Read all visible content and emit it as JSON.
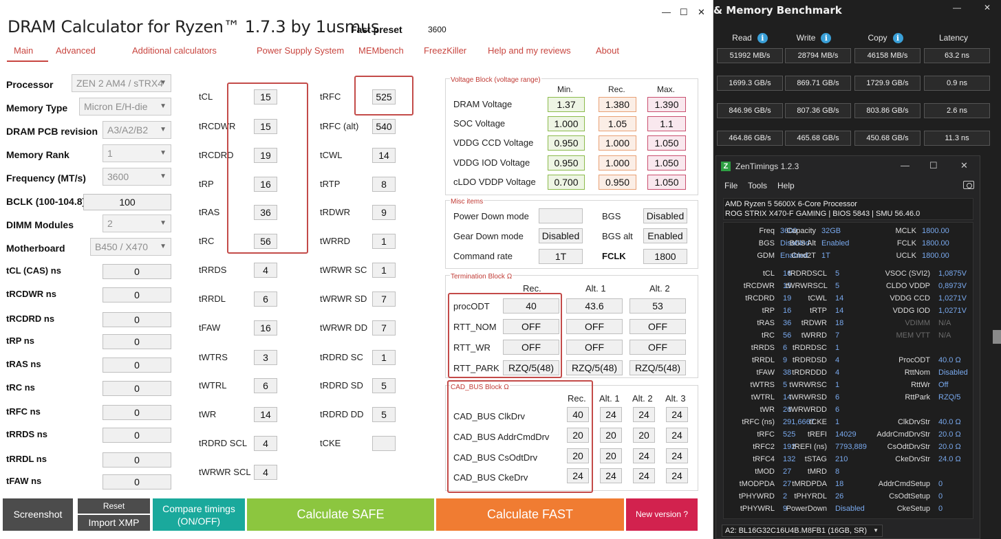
{
  "bench": {
    "title": "& Memory Benchmark",
    "headers": [
      "Read",
      "Write",
      "Copy",
      "Latency"
    ],
    "rows": [
      [
        "51992 MB/s",
        "28794 MB/s",
        "46158 MB/s",
        "63.2 ns"
      ],
      [
        "1699.3 GB/s",
        "869.71 GB/s",
        "1729.9 GB/s",
        "0.9 ns"
      ],
      [
        "846.96 GB/s",
        "807.36 GB/s",
        "803.86 GB/s",
        "2.6 ns"
      ],
      [
        "464.86 GB/s",
        "465.68 GB/s",
        "450.68 GB/s",
        "11.3 ns"
      ]
    ]
  },
  "zen": {
    "title": "ZenTimings 1.2.3",
    "menu": [
      "File",
      "Tools",
      "Help"
    ],
    "cpu": "AMD Ryzen 5 5600X 6-Core Processor",
    "board": "ROG STRIX X470-F GAMING | BIOS 5843 | SMU 56.46.0",
    "top": [
      [
        "Freq",
        "3600",
        "Capacity",
        "32GB",
        "MCLK",
        "1800.00"
      ],
      [
        "BGS",
        "Disabled",
        "BGS Alt",
        "Enabled",
        "FCLK",
        "1800.00"
      ],
      [
        "GDM",
        "Enabled",
        "Cmd2T",
        "1T",
        "UCLK",
        "1800.00"
      ]
    ],
    "rows": [
      [
        "tCL",
        "16",
        "tRDRDSCL",
        "5",
        "VSOC (SVI2)",
        "1,0875V"
      ],
      [
        "tRCDWR",
        "15",
        "tWRWRSCL",
        "5",
        "CLDO VDDP",
        "0,8973V"
      ],
      [
        "tRCDRD",
        "19",
        "tCWL",
        "14",
        "VDDG CCD",
        "1,0271V"
      ],
      [
        "tRP",
        "16",
        "tRTP",
        "14",
        "VDDG IOD",
        "1,0271V"
      ],
      [
        "tRAS",
        "36",
        "tRDWR",
        "18",
        "VDIMM",
        "N/A"
      ],
      [
        "tRC",
        "56",
        "tWRRD",
        "7",
        "MEM VTT",
        "N/A"
      ],
      [
        "tRRDS",
        "6",
        "tRDRDSC",
        "1",
        "",
        ""
      ],
      [
        "tRRDL",
        "9",
        "tRDRDSD",
        "4",
        "ProcODT",
        "40.0 Ω"
      ],
      [
        "tFAW",
        "38",
        "tRDRDDD",
        "4",
        "RttNom",
        "Disabled"
      ],
      [
        "tWTRS",
        "5",
        "tWRWRSC",
        "1",
        "RttWr",
        "Off"
      ],
      [
        "tWTRL",
        "14",
        "tWRWRSD",
        "6",
        "RttPark",
        "RZQ/5"
      ],
      [
        "tWR",
        "26",
        "tWRWRDD",
        "6",
        "",
        ""
      ],
      [
        "tRFC (ns)",
        "291,6667",
        "tCKE",
        "1",
        "ClkDrvStr",
        "40.0 Ω"
      ],
      [
        "tRFC",
        "525",
        "tREFI",
        "14029",
        "AddrCmdDrvStr",
        "20.0 Ω"
      ],
      [
        "tRFC2",
        "192",
        "tREFI (ns)",
        "7793,889",
        "CsOdtDrvStr",
        "20.0 Ω"
      ],
      [
        "tRFC4",
        "132",
        "tSTAG",
        "210",
        "CkeDrvStr",
        "24.0 Ω"
      ],
      [
        "tMOD",
        "27",
        "tMRD",
        "8",
        "",
        ""
      ],
      [
        "tMODPDA",
        "27",
        "tMRDPDA",
        "18",
        "AddrCmdSetup",
        "0"
      ],
      [
        "tPHYWRD",
        "2",
        "tPHYRDL",
        "26",
        "CsOdtSetup",
        "0"
      ],
      [
        "tPHYWRL",
        "9",
        "PowerDown",
        "Disabled",
        "CkeSetup",
        "0"
      ]
    ],
    "dimm": "A2: BL16G32C16U4B.M8FB1 (16GB, SR)"
  },
  "calc": {
    "title": "DRAM Calculator for Ryzen™ 1.7.3 by 1usmus",
    "preset_label": "Fast preset",
    "preset_value": "3600",
    "tabs": [
      "Main",
      "Advanced",
      "Additional calculators",
      "Power Supply System",
      "MEMbench",
      "FreezKiller",
      "Help and my reviews",
      "About"
    ],
    "left": [
      {
        "label": "Processor",
        "value": "ZEN 2 AM4 / sTRX4"
      },
      {
        "label": "Memory Type",
        "value": "Micron E/H-die"
      },
      {
        "label": "DRAM PCB revision",
        "value": "A3/A2/B2"
      },
      {
        "label": "Memory Rank",
        "value": "1"
      },
      {
        "label": "Frequency (MT/s)",
        "value": "3600"
      },
      {
        "label": "BCLK (100-104.8)",
        "value": "100"
      },
      {
        "label": "DIMM Modules",
        "value": "2"
      },
      {
        "label": "Motherboard",
        "value": "B450 / X470"
      }
    ],
    "ns": [
      {
        "label": "tCL (CAS) ns",
        "value": "0"
      },
      {
        "label": "tRCDWR ns",
        "value": "0"
      },
      {
        "label": "tRCDRD ns",
        "value": "0"
      },
      {
        "label": "tRP ns",
        "value": "0"
      },
      {
        "label": "tRAS ns",
        "value": "0"
      },
      {
        "label": "tRC ns",
        "value": "0"
      },
      {
        "label": "tRFC ns",
        "value": "0"
      },
      {
        "label": "tRRDS ns",
        "value": "0"
      },
      {
        "label": "tRRDL ns",
        "value": "0"
      },
      {
        "label": "tFAW ns",
        "value": "0"
      }
    ],
    "t1": [
      {
        "label": "tCL",
        "value": "15"
      },
      {
        "label": "tRCDWR",
        "value": "15"
      },
      {
        "label": "tRCDRD",
        "value": "19"
      },
      {
        "label": "tRP",
        "value": "16"
      },
      {
        "label": "tRAS",
        "value": "36"
      },
      {
        "label": "tRC",
        "value": "56"
      },
      {
        "label": "tRRDS",
        "value": "4"
      },
      {
        "label": "tRRDL",
        "value": "6"
      },
      {
        "label": "tFAW",
        "value": "16"
      },
      {
        "label": "tWTRS",
        "value": "3"
      },
      {
        "label": "tWTRL",
        "value": "6"
      },
      {
        "label": "tWR",
        "value": "14"
      },
      {
        "label": "tRDRD SCL",
        "value": "4"
      },
      {
        "label": "tWRWR SCL",
        "value": "4"
      }
    ],
    "t2": [
      {
        "label": "tRFC",
        "value": "525"
      },
      {
        "label": "tRFC (alt)",
        "value": "540"
      },
      {
        "label": "tCWL",
        "value": "14"
      },
      {
        "label": "tRTP",
        "value": "8"
      },
      {
        "label": "tRDWR",
        "value": "9"
      },
      {
        "label": "tWRRD",
        "value": "1"
      },
      {
        "label": "tWRWR SC",
        "value": "1"
      },
      {
        "label": "tWRWR SD",
        "value": "7"
      },
      {
        "label": "tWRWR DD",
        "value": "7"
      },
      {
        "label": "tRDRD SC",
        "value": "1"
      },
      {
        "label": "tRDRD SD",
        "value": "5"
      },
      {
        "label": "tRDRD DD",
        "value": "5"
      },
      {
        "label": "tCKE",
        "value": ""
      }
    ],
    "voltage": {
      "title": "Voltage Block (voltage range)",
      "cols": [
        "Min.",
        "Rec.",
        "Max."
      ],
      "rows": [
        {
          "label": "DRAM Voltage",
          "min": "1.37",
          "rec": "1.380",
          "max": "1.390"
        },
        {
          "label": "SOC Voltage",
          "min": "1.000",
          "rec": "1.05",
          "max": "1.1"
        },
        {
          "label": "VDDG  CCD Voltage",
          "min": "0.950",
          "rec": "1.000",
          "max": "1.050"
        },
        {
          "label": "VDDG  IOD Voltage",
          "min": "0.950",
          "rec": "1.000",
          "max": "1.050"
        },
        {
          "label": "cLDO VDDP Voltage",
          "min": "0.700",
          "rec": "0.950",
          "max": "1.050"
        }
      ]
    },
    "misc": {
      "title": "Misc items",
      "power_down_label": "Power Down mode",
      "power_down_value": "",
      "gear_down_label": "Gear Down mode",
      "gear_down_value": "Disabled",
      "cmd_rate_label": "Command rate",
      "cmd_rate_value": "1T",
      "bgs_label": "BGS",
      "bgs_value": "Disabled",
      "bgs_alt_label": "BGS alt",
      "bgs_alt_value": "Enabled",
      "fclk_label": "FCLK",
      "fclk_value": "1800"
    },
    "term": {
      "title": "Termination Block Ω",
      "cols": [
        "Rec.",
        "Alt. 1",
        "Alt. 2"
      ],
      "rows": [
        {
          "label": "procODT",
          "v": [
            "40",
            "43.6",
            "53"
          ]
        },
        {
          "label": "RTT_NOM",
          "v": [
            "OFF",
            "OFF",
            "OFF"
          ]
        },
        {
          "label": "RTT_WR",
          "v": [
            "OFF",
            "OFF",
            "OFF"
          ]
        },
        {
          "label": "RTT_PARK",
          "v": [
            "RZQ/5(48)",
            "RZQ/5(48)",
            "RZQ/5(48)"
          ]
        }
      ]
    },
    "cad": {
      "title": "CAD_BUS Block Ω",
      "cols": [
        "Rec.",
        "Alt. 1",
        "Alt. 2",
        "Alt. 3"
      ],
      "rows": [
        {
          "label": "CAD_BUS ClkDrv",
          "v": [
            "40",
            "24",
            "24",
            "24"
          ]
        },
        {
          "label": "CAD_BUS AddrCmdDrv",
          "v": [
            "20",
            "20",
            "20",
            "24"
          ]
        },
        {
          "label": "CAD_BUS CsOdtDrv",
          "v": [
            "20",
            "20",
            "24",
            "24"
          ]
        },
        {
          "label": "CAD_BUS CkeDrv",
          "v": [
            "24",
            "24",
            "24",
            "24"
          ]
        }
      ]
    },
    "buttons": {
      "screenshot": "Screenshot",
      "reset": "Reset",
      "import": "Import XMP",
      "compare1": "Compare timings",
      "compare2": "(ON/OFF)",
      "safe": "Calculate SAFE",
      "fast": "Calculate FAST",
      "new": "New version ?"
    }
  },
  "colors": {
    "accent": "#c8453f",
    "safe": "#8cc63f",
    "fast": "#f07c32",
    "compare": "#1aa99c",
    "new": "#d2224e",
    "dark": "#4c4c4c"
  }
}
